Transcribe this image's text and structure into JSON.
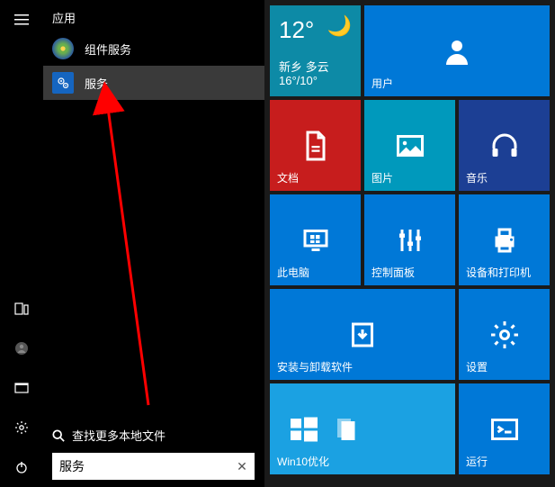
{
  "apps": {
    "header": "应用",
    "items": [
      {
        "label": "组件服务"
      },
      {
        "label": "服务"
      }
    ]
  },
  "search": {
    "hint": "查找更多本地文件",
    "value": "服务",
    "clear": "✕"
  },
  "weather": {
    "temp": "12°",
    "location_desc": "新乡 多云",
    "range": "16°/10°",
    "moon": "🌙"
  },
  "tiles": {
    "user": "用户",
    "docs": "文档",
    "pics": "图片",
    "music": "音乐",
    "pc": "此电脑",
    "control": "控制面板",
    "printers": "设备和打印机",
    "install": "安装与卸载软件",
    "settings": "设置",
    "win10opt": "Win10优化",
    "run": "运行"
  }
}
